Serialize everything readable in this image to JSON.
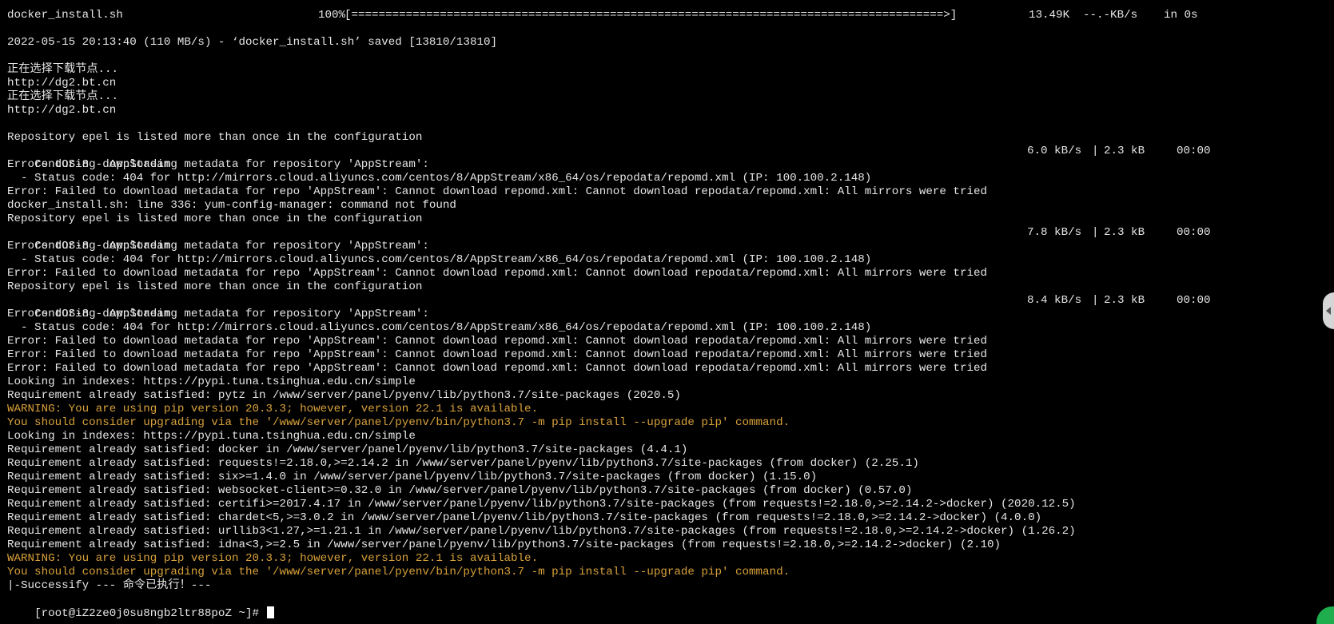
{
  "download": {
    "filename": "docker_install.sh",
    "percent": "100%",
    "bar": "[=======================================================================================>]",
    "size": "13.49K",
    "speed": "--.-KB/s",
    "eta": "in 0s"
  },
  "lines": [
    "",
    "2022-05-15 20:13:40 (110 MB/s) - ‘docker_install.sh’ saved [13810/13810]",
    "",
    "正在选择下载节点...",
    "http://dg2.bt.cn",
    "正在选择下载节点...",
    "http://dg2.bt.cn",
    "",
    "Repository epel is listed more than once in the configuration",
    "CentOS-8 - AppStream",
    "Errors during downloading metadata for repository 'AppStream':",
    "  - Status code: 404 for http://mirrors.cloud.aliyuncs.com/centos/8/AppStream/x86_64/os/repodata/repomd.xml (IP: 100.100.2.148)",
    "Error: Failed to download metadata for repo 'AppStream': Cannot download repomd.xml: Cannot download repodata/repomd.xml: All mirrors were tried",
    "docker_install.sh: line 336: yum-config-manager: command not found",
    "Repository epel is listed more than once in the configuration",
    "CentOS-8 - AppStream",
    "Errors during downloading metadata for repository 'AppStream':",
    "  - Status code: 404 for http://mirrors.cloud.aliyuncs.com/centos/8/AppStream/x86_64/os/repodata/repomd.xml (IP: 100.100.2.148)",
    "Error: Failed to download metadata for repo 'AppStream': Cannot download repomd.xml: Cannot download repodata/repomd.xml: All mirrors were tried",
    "Repository epel is listed more than once in the configuration",
    "CentOS-8 - AppStream",
    "Errors during downloading metadata for repository 'AppStream':",
    "  - Status code: 404 for http://mirrors.cloud.aliyuncs.com/centos/8/AppStream/x86_64/os/repodata/repomd.xml (IP: 100.100.2.148)",
    "Error: Failed to download metadata for repo 'AppStream': Cannot download repomd.xml: Cannot download repodata/repomd.xml: All mirrors were tried",
    "Error: Failed to download metadata for repo 'AppStream': Cannot download repomd.xml: Cannot download repodata/repomd.xml: All mirrors were tried",
    "Error: Failed to download metadata for repo 'AppStream': Cannot download repomd.xml: Cannot download repodata/repomd.xml: All mirrors were tried",
    "Looking in indexes: https://pypi.tuna.tsinghua.edu.cn/simple",
    "Requirement already satisfied: pytz in /www/server/panel/pyenv/lib/python3.7/site-packages (2020.5)",
    "WARNING: You are using pip version 20.3.3; however, version 22.1 is available.",
    "You should consider upgrading via the '/www/server/panel/pyenv/bin/python3.7 -m pip install --upgrade pip' command.",
    "Looking in indexes: https://pypi.tuna.tsinghua.edu.cn/simple",
    "Requirement already satisfied: docker in /www/server/panel/pyenv/lib/python3.7/site-packages (4.4.1)",
    "Requirement already satisfied: requests!=2.18.0,>=2.14.2 in /www/server/panel/pyenv/lib/python3.7/site-packages (from docker) (2.25.1)",
    "Requirement already satisfied: six>=1.4.0 in /www/server/panel/pyenv/lib/python3.7/site-packages (from docker) (1.15.0)",
    "Requirement already satisfied: websocket-client>=0.32.0 in /www/server/panel/pyenv/lib/python3.7/site-packages (from docker) (0.57.0)",
    "Requirement already satisfied: certifi>=2017.4.17 in /www/server/panel/pyenv/lib/python3.7/site-packages (from requests!=2.18.0,>=2.14.2->docker) (2020.12.5)",
    "Requirement already satisfied: chardet<5,>=3.0.2 in /www/server/panel/pyenv/lib/python3.7/site-packages (from requests!=2.18.0,>=2.14.2->docker) (4.0.0)",
    "Requirement already satisfied: urllib3<1.27,>=1.21.1 in /www/server/panel/pyenv/lib/python3.7/site-packages (from requests!=2.18.0,>=2.14.2->docker) (1.26.2)",
    "Requirement already satisfied: idna<3,>=2.5 in /www/server/panel/pyenv/lib/python3.7/site-packages (from requests!=2.18.0,>=2.14.2->docker) (2.10)",
    "WARNING: You are using pip version 20.3.3; however, version 22.1 is available.",
    "You should consider upgrading via the '/www/server/panel/pyenv/bin/python3.7 -m pip install --upgrade pip' command.",
    "|-Successify --- 命令已执行！---"
  ],
  "appstream_stats": [
    {
      "speed": "6.0 kB/s",
      "size": "2.3 kB",
      "time": "00:00"
    },
    {
      "speed": "7.8 kB/s",
      "size": "2.3 kB",
      "time": "00:00"
    },
    {
      "speed": "8.4 kB/s",
      "size": "2.3 kB",
      "time": "00:00"
    }
  ],
  "prompt": "[root@iZ2ze0j0su8ngb2ltr88poZ ~]# ",
  "colors": {
    "background": "#000000",
    "text": "#e6e6e6",
    "warning": "#d8a13a"
  }
}
